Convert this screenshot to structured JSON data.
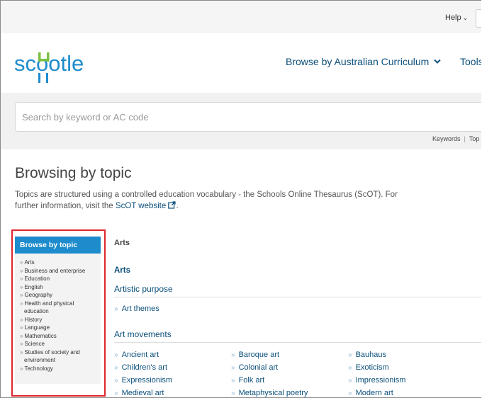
{
  "topbar": {
    "help_label": "Help"
  },
  "header": {
    "logo_text": "scootle",
    "nav_browse_label": "Browse by Australian Curriculum",
    "nav_tools_label": "Tools"
  },
  "search": {
    "placeholder": "Search by keyword or AC code",
    "links": [
      "Keywords",
      "Top"
    ]
  },
  "page": {
    "title": "Browsing by topic",
    "intro_text": "Topics are structured using a controlled education vocabulary - the Schools Online Thesaurus (ScOT). For further information, visit the ",
    "intro_link": "ScOT website",
    "intro_end": "."
  },
  "sidebar": {
    "heading": "Browse by topic",
    "items": [
      {
        "label": "Arts"
      },
      {
        "label": "Business and enterprise"
      },
      {
        "label": "Education"
      },
      {
        "label": "English"
      },
      {
        "label": "Geography"
      },
      {
        "label": "Health and physical",
        "cont": "education"
      },
      {
        "label": "History"
      },
      {
        "label": "Language"
      },
      {
        "label": "Mathematics"
      },
      {
        "label": "Science"
      },
      {
        "label": "Studies of society and",
        "cont": "environment"
      },
      {
        "label": "Technology"
      }
    ]
  },
  "main": {
    "section_heading": "Arts",
    "sub_heading": "Arts",
    "artistic_purpose": {
      "title": "Artistic purpose",
      "items": [
        "Art themes"
      ]
    },
    "art_movements": {
      "title": "Art movements",
      "columns": [
        [
          "Ancient art",
          "Children's art",
          "Expressionism",
          "Medieval art"
        ],
        [
          "Baroque art",
          "Colonial art",
          "Folk art",
          "Metaphysical poetry"
        ],
        [
          "Bauhaus",
          "Exoticism",
          "Impressionism",
          "Modern art"
        ]
      ]
    }
  },
  "colors": {
    "brand_blue": "#1e8ccc",
    "link_blue": "#0b4f7a",
    "logo_green": "#7ac143",
    "highlight_red": "#e0262d"
  }
}
